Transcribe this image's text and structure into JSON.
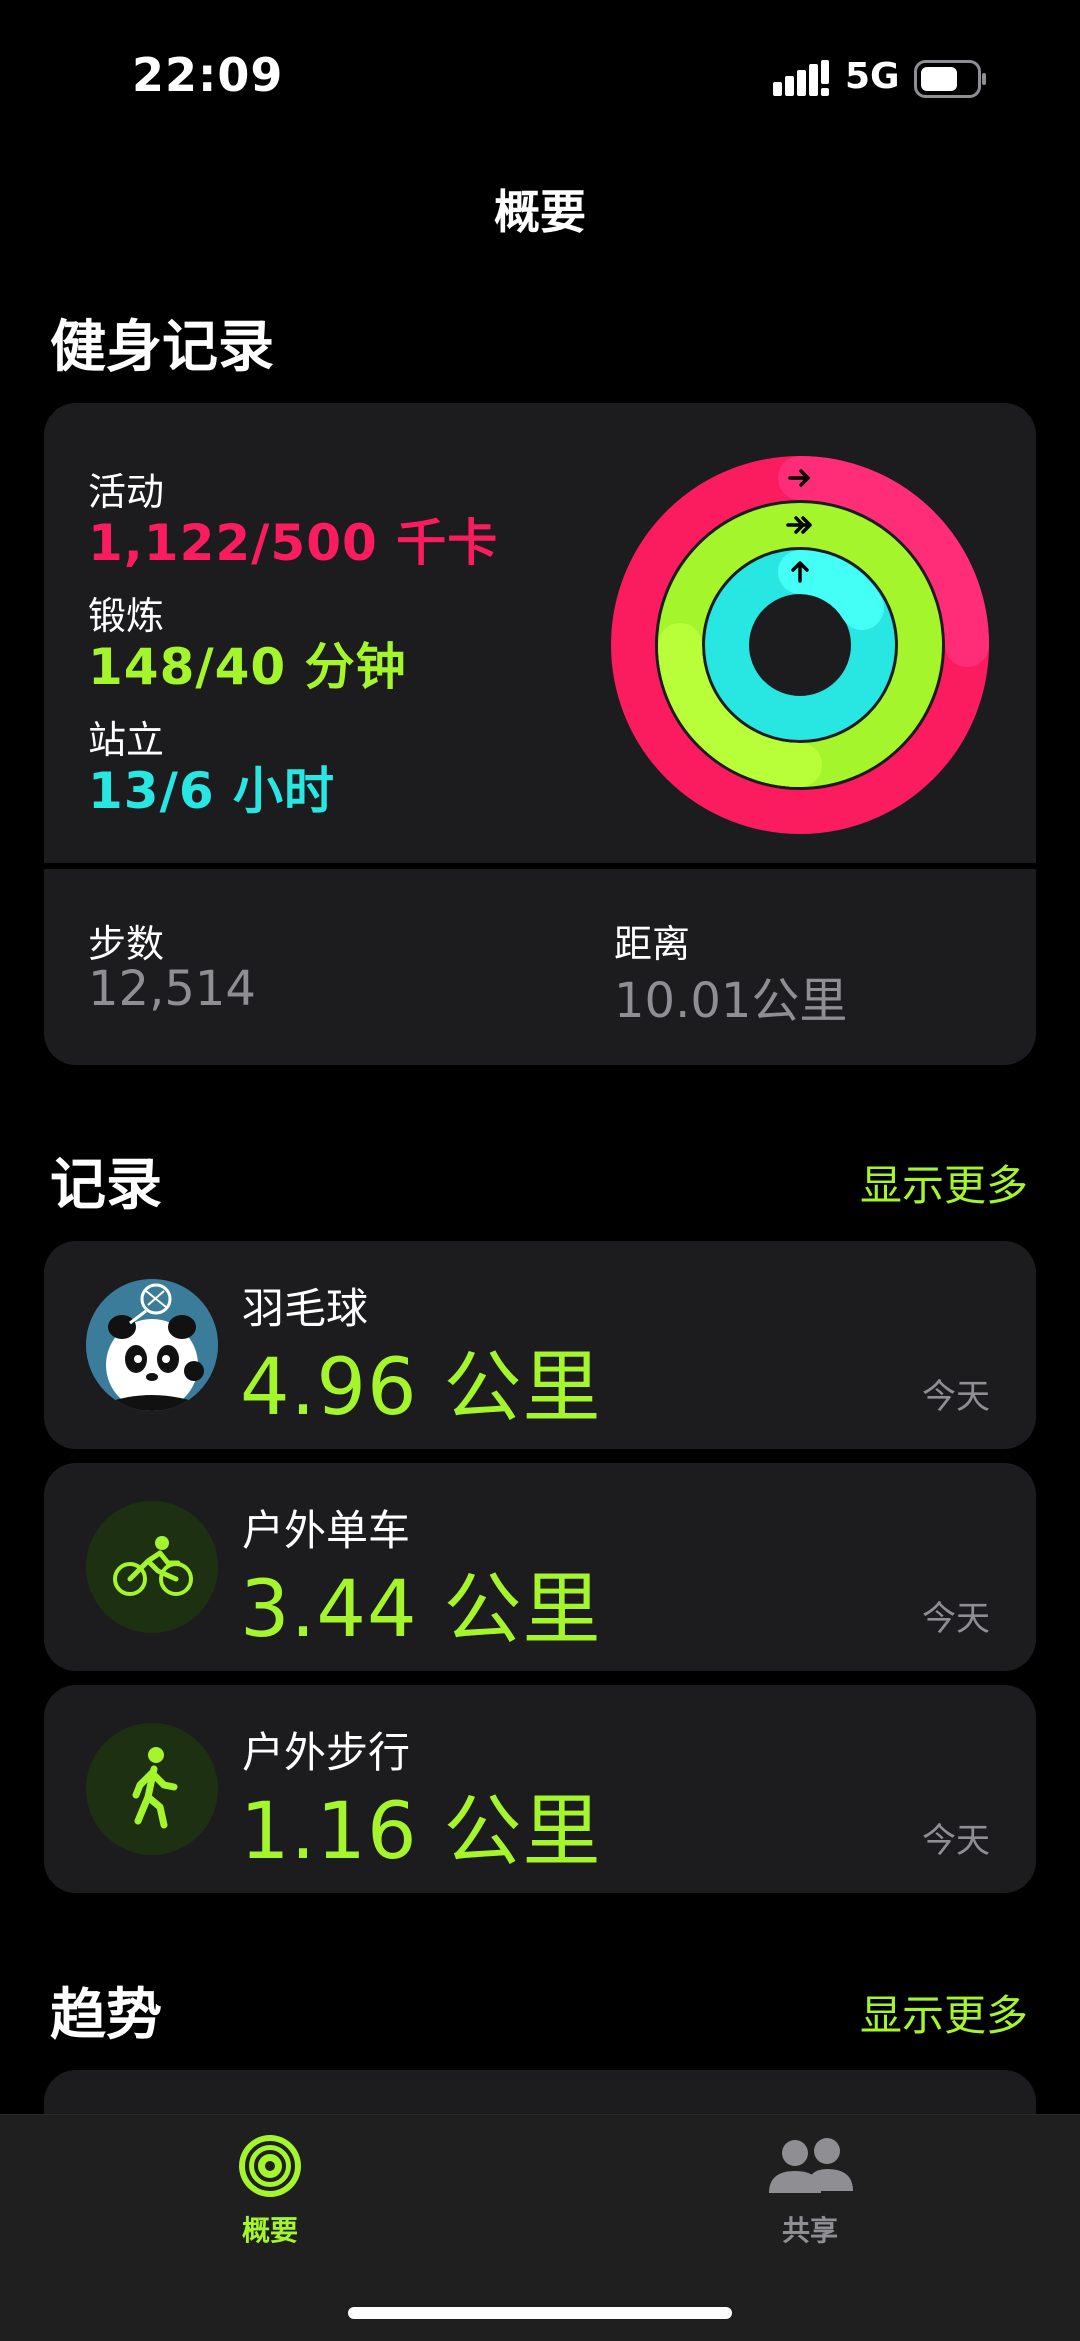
{
  "status_bar": {
    "time": "22:09",
    "network": "5G"
  },
  "nav": {
    "title": "概要"
  },
  "fitness": {
    "section_title": "健身记录",
    "move_label": "活动",
    "move_value": "1,122/500 千卡",
    "exercise_label": "锻炼",
    "exercise_value": "148/40 分钟",
    "stand_label": "站立",
    "stand_value": "13/6 小时",
    "steps_label": "步数",
    "steps_value": "12,514",
    "distance_label": "距离",
    "distance_value": "10.01公里",
    "ring_colors": {
      "move": "#fa1c5f",
      "exercise": "#a4f52b",
      "stand": "#28e6e1"
    }
  },
  "workouts": {
    "section_title": "记录",
    "show_more": "显示更多",
    "items": [
      {
        "name": "羽毛球",
        "value": "4.96 公里",
        "date": "今天",
        "icon": "panda-avatar-icon"
      },
      {
        "name": "户外单车",
        "value": "3.44 公里",
        "date": "今天",
        "icon": "cycling-icon"
      },
      {
        "name": "户外步行",
        "value": "1.16 公里",
        "date": "今天",
        "icon": "walking-icon"
      }
    ]
  },
  "trends": {
    "section_title": "趋势",
    "show_more": "显示更多"
  },
  "tab_bar": {
    "tabs": [
      {
        "label": "概要",
        "icon": "activity-rings-icon",
        "active": true
      },
      {
        "label": "共享",
        "icon": "people-icon",
        "active": false
      }
    ]
  },
  "colors": {
    "accent": "#a4f52b",
    "card": "#1c1c1e",
    "inactive": "#8e8e93"
  }
}
